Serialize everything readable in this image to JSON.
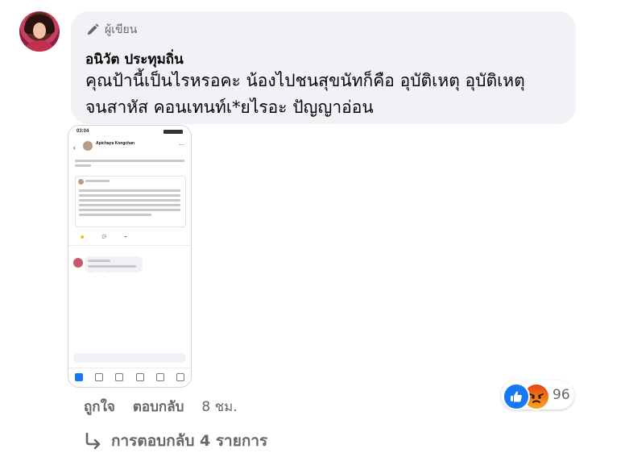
{
  "comment": {
    "author_badge": "ผู้เขียน",
    "commenter_name": "อนิวัต ประทุมถิ่น",
    "text_line1": "คุณป้านี้เป็นไรหรอคะ น้องไปชนสุขนัทก็คือ อุบัติเหตุ อุบัติเหตุ",
    "text_line2": "จนสาหัส คอนเทนท์เ*ยไรอะ ปัญญาอ่อน"
  },
  "screenshot": {
    "status_time": "03:04",
    "post_author": "Apichaya Kongchan"
  },
  "actions": {
    "like": "ถูกใจ",
    "reply": "ตอบกลับ",
    "time": "8 ชม."
  },
  "reactions": {
    "count": "96",
    "icons": [
      "like-icon",
      "angry-icon"
    ],
    "colors": {
      "like": "#1877f2",
      "angry": "#e9440f"
    }
  },
  "replies": {
    "label": "การตอบกลับ 4 รายการ"
  }
}
